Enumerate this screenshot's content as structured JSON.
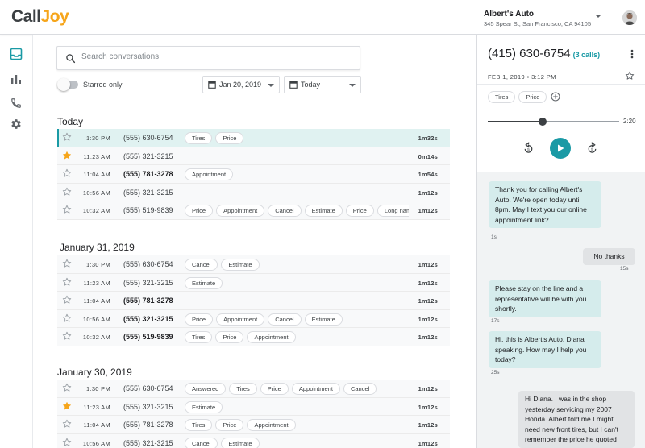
{
  "app": {
    "logo_part1": "Call",
    "logo_part2": "Joy"
  },
  "business": {
    "name": "Albert's Auto",
    "address": "345 Spear St, San Francisco, CA 94105"
  },
  "nav": [
    "inbox-icon",
    "bar-chart-icon",
    "phone-icon",
    "gear-icon"
  ],
  "search": {
    "placeholder": "Search conversations"
  },
  "filters": {
    "starred_label": "Starred only",
    "date_from": "Jan 20, 2019",
    "date_to": "Today"
  },
  "sections": [
    {
      "title": "Today",
      "rows": [
        {
          "starred": false,
          "time": "1:30 PM",
          "phone": "(555) 630-6754",
          "bold": false,
          "tags": [
            "Tires",
            "Price"
          ],
          "duration": "1m32s",
          "selected": true
        },
        {
          "starred": true,
          "time": "11:23 AM",
          "phone": "(555) 321-3215",
          "bold": false,
          "tags": [],
          "duration": "0m14s"
        },
        {
          "starred": false,
          "time": "11:04 AM",
          "phone": "(555) 781-3278",
          "bold": true,
          "tags": [
            "Appointment"
          ],
          "duration": "1m54s"
        },
        {
          "starred": false,
          "time": "10:56 AM",
          "phone": "(555) 321-3215",
          "bold": false,
          "tags": [],
          "duration": "1m12s"
        },
        {
          "starred": false,
          "time": "10:32 AM",
          "phone": "(555) 519-9839",
          "bold": false,
          "tags": [
            "Price",
            "Appointment",
            "Cancel",
            "Estimate",
            "Price",
            "Long name"
          ],
          "duration": "1m12s"
        }
      ]
    },
    {
      "title": "January 31, 2019",
      "rows": [
        {
          "starred": false,
          "time": "1:30 PM",
          "phone": "(555) 630-6754",
          "bold": false,
          "tags": [
            "Cancel",
            "Estimate"
          ],
          "duration": "1m12s"
        },
        {
          "starred": false,
          "time": "11:23 AM",
          "phone": "(555) 321-3215",
          "bold": false,
          "tags": [
            "Estimate"
          ],
          "duration": "1m12s"
        },
        {
          "starred": false,
          "time": "11:04 AM",
          "phone": "(555) 781-3278",
          "bold": true,
          "tags": [],
          "duration": "1m12s"
        },
        {
          "starred": false,
          "time": "10:56 AM",
          "phone": "(555) 321-3215",
          "bold": true,
          "tags": [
            "Price",
            "Appointment",
            "Cancel",
            "Estimate"
          ],
          "duration": "1m12s"
        },
        {
          "starred": false,
          "time": "10:32 AM",
          "phone": "(555) 519-9839",
          "bold": true,
          "tags": [
            "Tires",
            "Price",
            "Appointment"
          ],
          "duration": "1m12s"
        }
      ]
    },
    {
      "title": "January 30, 2019",
      "rows": [
        {
          "starred": false,
          "time": "1:30 PM",
          "phone": "(555) 630-6754",
          "bold": false,
          "tags": [
            "Answered",
            "Tires",
            "Price",
            "Appointment",
            "Cancel"
          ],
          "duration": "1m12s"
        },
        {
          "starred": true,
          "time": "11:23 AM",
          "phone": "(555) 321-3215",
          "bold": false,
          "tags": [
            "Estimate"
          ],
          "duration": "1m12s"
        },
        {
          "starred": false,
          "time": "11:04 AM",
          "phone": "(555) 781-3278",
          "bold": false,
          "tags": [
            "Tires",
            "Price",
            "Appointment"
          ],
          "duration": "1m12s"
        },
        {
          "starred": false,
          "time": "10:56 AM",
          "phone": "(555) 321-3215",
          "bold": false,
          "tags": [
            "Cancel",
            "Estimate"
          ],
          "duration": "1m12s"
        }
      ]
    }
  ],
  "detail": {
    "phone": "(415) 630-6754",
    "calls": "(3 calls)",
    "date": "FEB 1, 2019 • 3:12 PM",
    "tags": [
      "Tires",
      "Price"
    ],
    "duration": "2:20",
    "progress": 0.42,
    "rewind_label": "5",
    "forward_label": "5",
    "messages": [
      {
        "side": "in",
        "text": "Thank you for calling Albert's Auto. We're open today until 8pm. May I text you our online appointment link?",
        "meta": "1s"
      },
      {
        "side": "out",
        "text": "No thanks",
        "meta": "15s"
      },
      {
        "side": "in",
        "text": "Please stay on the line and a representative will be with you shortly.",
        "meta": "17s"
      },
      {
        "side": "in",
        "text": "Hi, this is Albert's Auto. Diana speaking. How may I help you today?",
        "meta": "25s"
      },
      {
        "side": "out",
        "text": "Hi Diana. I was in the shop yesterday servicing my 2007 Honda. Albert told me I might need new front tires, but I can't remember the price he quoted",
        "meta": ""
      }
    ]
  },
  "colors": {
    "accent": "#1a9aa5",
    "star": "#f6a51a",
    "logo_gray": "#3c4043"
  }
}
